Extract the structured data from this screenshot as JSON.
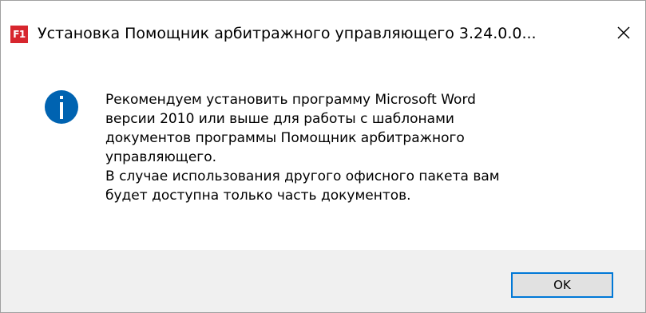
{
  "window": {
    "app_icon_label": "F1",
    "title": "Установка Помощник арбитражного управляющего 3.24.0.0...",
    "close_glyph": "✕"
  },
  "message": {
    "icon": "info-icon",
    "lines": [
      "Рекомендуем установить программу Microsoft Word",
      "версии 2010 или выше для работы с шаблонами",
      "документов программы Помощник арбитражного",
      "управляющего.",
      "В случае использования другого офисного пакета вам",
      "будет доступна только часть документов."
    ]
  },
  "buttons": {
    "ok_label": "OK"
  },
  "colors": {
    "info_icon": "#0063b1",
    "app_icon": "#d7262e",
    "button_focus_border": "#0078d7",
    "footer_bg": "#f0f0f0"
  }
}
